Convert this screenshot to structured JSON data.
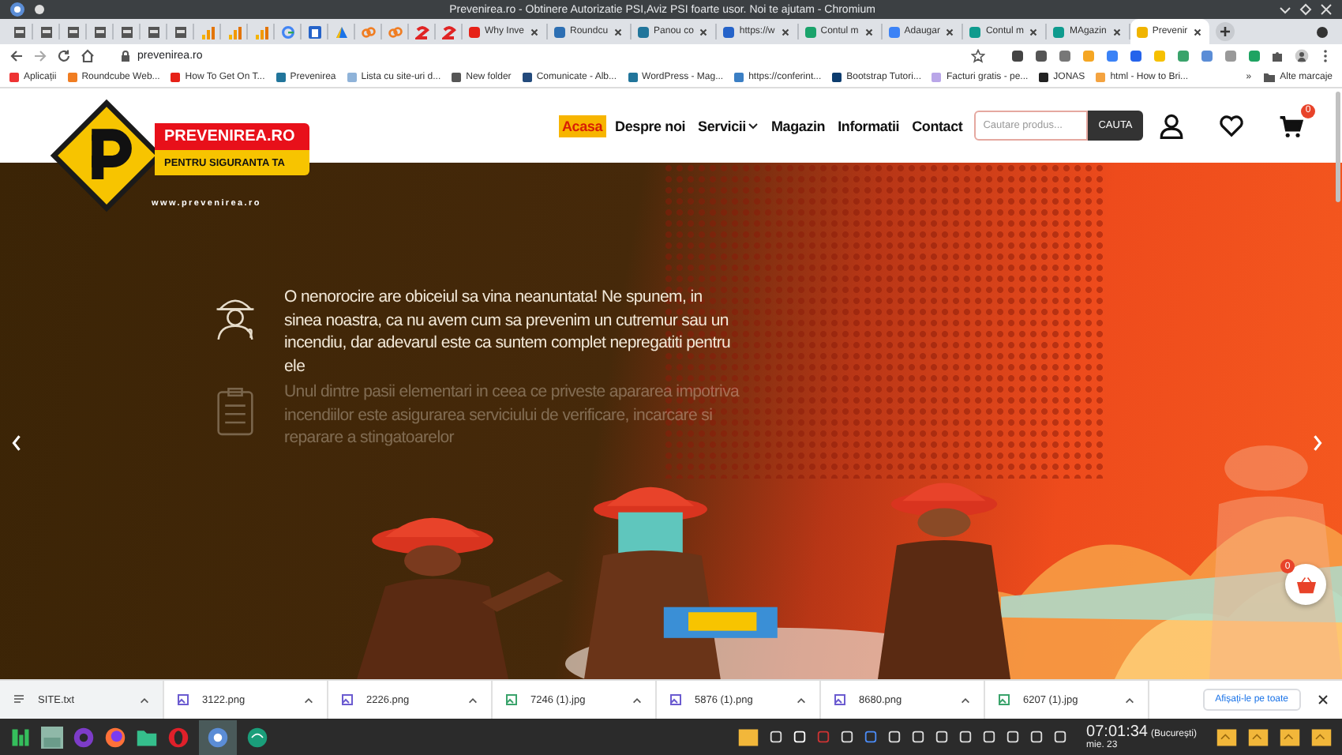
{
  "window": {
    "title": "Prevenirea.ro - Obtinere Autorizatie PSI,Aviz PSI foarte usor. Noi te ajutam - Chromium"
  },
  "tabs": [
    {
      "selected": false
    },
    {
      "selected": false
    },
    {
      "selected": false
    },
    {
      "selected": false
    },
    {
      "selected": false
    },
    {
      "selected": false
    },
    {
      "selected": false
    },
    {
      "selected": false
    },
    {
      "selected": false
    },
    {
      "selected": false
    },
    {
      "selected": false
    },
    {
      "selected": false
    },
    {
      "selected": false
    },
    {
      "selected": false
    },
    {
      "selected": false
    },
    {
      "selected": false
    },
    {
      "selected": false
    },
    {
      "label": "Why Inve",
      "selected": false
    },
    {
      "label": "Roundcu",
      "selected": false
    },
    {
      "label": "Panou co",
      "selected": false
    },
    {
      "label": "https://w",
      "selected": false
    },
    {
      "label": "Contul m",
      "selected": false
    },
    {
      "label": "Adaugar",
      "selected": false
    },
    {
      "label": "Contul m",
      "selected": false
    },
    {
      "label": "MAgazin",
      "selected": false
    },
    {
      "label": "Prevenir",
      "selected": true
    }
  ],
  "address_bar": {
    "url": "prevenirea.ro"
  },
  "bookmarks": [
    {
      "label": "Aplicații"
    },
    {
      "label": "Roundcube Web..."
    },
    {
      "label": "How To Get On T..."
    },
    {
      "label": "Prevenirea"
    },
    {
      "label": "Lista cu site-uri d..."
    },
    {
      "label": "New folder"
    },
    {
      "label": "Comunicate - Alb..."
    },
    {
      "label": "WordPress - Mag..."
    },
    {
      "label": "https://conferint..."
    },
    {
      "label": "Bootstrap Tutori..."
    },
    {
      "label": "Facturi gratis - pe..."
    },
    {
      "label": "JONAS"
    },
    {
      "label": "html - How to Bri..."
    }
  ],
  "bookmarks_overflow": "»",
  "other_bookmarks": "Alte marcaje",
  "site": {
    "logo": {
      "name": "PREVENIREA.RO",
      "tagline": "PENTRU SIGURANTA TA",
      "url": "www.prevenirea.ro"
    },
    "nav": [
      {
        "label": "Acasa",
        "selected": true,
        "dropdown": false
      },
      {
        "label": "Despre noi",
        "selected": false,
        "dropdown": false
      },
      {
        "label": "Servicii",
        "selected": false,
        "dropdown": true
      },
      {
        "label": "Magazin",
        "selected": false,
        "dropdown": false
      },
      {
        "label": "Informatii",
        "selected": false,
        "dropdown": false
      },
      {
        "label": "Contact",
        "selected": false,
        "dropdown": false
      }
    ],
    "search": {
      "placeholder": "Cautare produs...",
      "button": "CAUTA"
    },
    "cart_count": "0"
  },
  "hero": {
    "paragraphs": [
      {
        "text": "O nenorocire are obiceiul sa vina neanuntata! Ne spunem, in sinea noastra, ca nu avem cum sa prevenim un cutremur sau un incendiu, dar adevarul este ca suntem complet nepregatiti pentru ele",
        "faded": false
      },
      {
        "text": "Unul dintre pasii elementari in ceea ce priveste apararea impotriva incendiilor este asigurarea serviciului de verificare, incarcare si reparare a stingatoarelor",
        "faded": true
      }
    ]
  },
  "floating_cart": {
    "count": "0"
  },
  "downloads": [
    {
      "name": "SITE.txt",
      "kind": "txt"
    },
    {
      "name": "3122.png",
      "kind": "png"
    },
    {
      "name": "2226.png",
      "kind": "png"
    },
    {
      "name": "7246 (1).jpg",
      "kind": "jpg"
    },
    {
      "name": "5876 (1).png",
      "kind": "png"
    },
    {
      "name": "8680.png",
      "kind": "png"
    },
    {
      "name": "6207 (1).jpg",
      "kind": "jpg"
    }
  ],
  "downloads_show_all": "Afișați-le pe toate",
  "taskbar": {
    "time": "07:01:34",
    "timezone": "(București)",
    "date": "mie. 23"
  }
}
